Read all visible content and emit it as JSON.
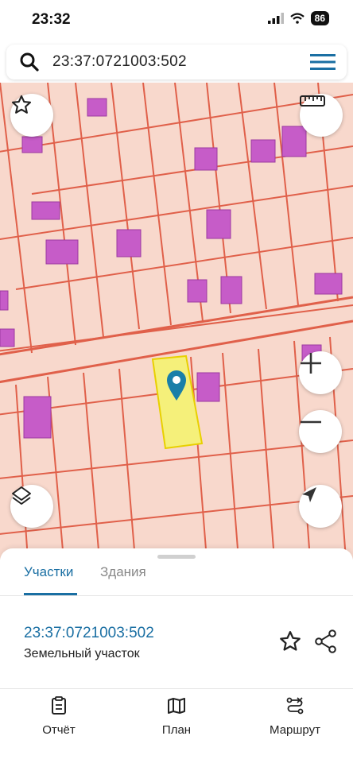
{
  "status": {
    "time": "23:32",
    "battery": "86"
  },
  "search": {
    "query": "23:37:0721003:502"
  },
  "sheet": {
    "tabs": [
      {
        "label": "Участки",
        "active": true
      },
      {
        "label": "Здания",
        "active": false
      }
    ],
    "parcel": {
      "id": "23:37:0721003:502",
      "type": "Земельный участок"
    },
    "actions": [
      {
        "label": "Отчёт",
        "icon": "report-icon"
      },
      {
        "label": "План",
        "icon": "map-plan-icon"
      },
      {
        "label": "Маршрут",
        "icon": "route-icon"
      }
    ]
  },
  "colors": {
    "accent": "#1a6fa3",
    "map_background": "#f8d8cc",
    "parcel_border": "#e0604a",
    "building": "#c65cc8",
    "selected_parcel": "#f5f07a"
  }
}
